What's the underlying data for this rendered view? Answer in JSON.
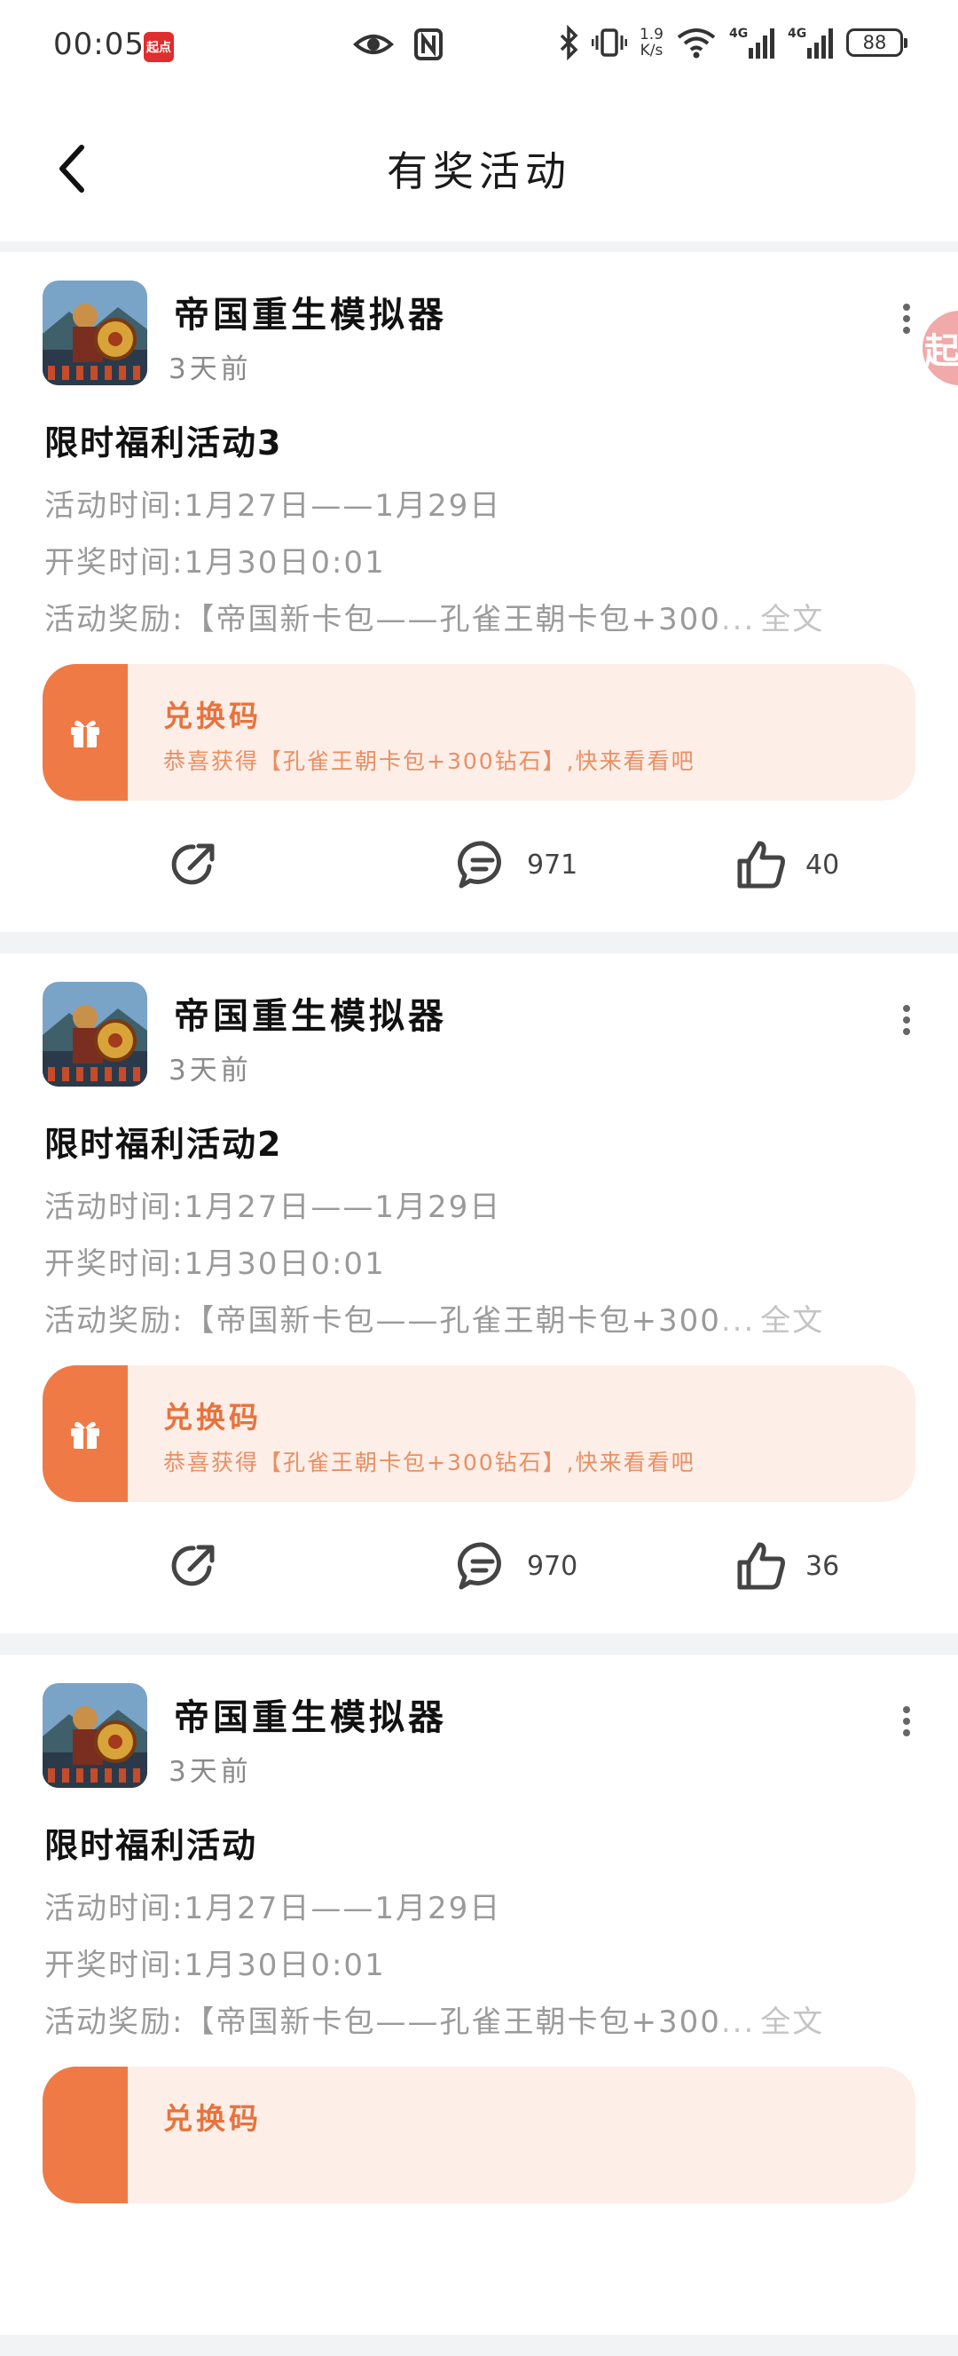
{
  "status_bar": {
    "time": "00:05",
    "app_badge": "起点",
    "net_speed_value": "1.9",
    "net_speed_unit": "K/s",
    "battery": "88"
  },
  "header": {
    "title": "有奖活动"
  },
  "floating_badge": "起",
  "posts": [
    {
      "game_name": "帝国重生模拟器",
      "time_ago": "3天前",
      "title": "限时福利活动3",
      "activity_time": "活动时间:1月27日——1月29日",
      "draw_time": "开奖时间:1月30日0:01",
      "reward": "活动奖励:【帝国新卡包——孔雀王朝卡包+300",
      "ellipsis": "...",
      "full_text_label": "全文",
      "code_title": "兑换码",
      "code_desc": "恭喜获得【孔雀王朝卡包+300钻石】,快来看看吧",
      "comments": "971",
      "likes": "40"
    },
    {
      "game_name": "帝国重生模拟器",
      "time_ago": "3天前",
      "title": "限时福利活动2",
      "activity_time": "活动时间:1月27日——1月29日",
      "draw_time": "开奖时间:1月30日0:01",
      "reward": "活动奖励:【帝国新卡包——孔雀王朝卡包+300",
      "ellipsis": "...",
      "full_text_label": "全文",
      "code_title": "兑换码",
      "code_desc": "恭喜获得【孔雀王朝卡包+300钻石】,快来看看吧",
      "comments": "970",
      "likes": "36"
    },
    {
      "game_name": "帝国重生模拟器",
      "time_ago": "3天前",
      "title": "限时福利活动",
      "activity_time": "活动时间:1月27日——1月29日",
      "draw_time": "开奖时间:1月30日0:01",
      "reward": "活动奖励:【帝国新卡包——孔雀王朝卡包+300",
      "ellipsis": "...",
      "full_text_label": "全文",
      "code_title": "兑换码",
      "code_desc": "",
      "comments": "",
      "likes": ""
    }
  ],
  "colors": {
    "accent": "#ef7a46",
    "code_bg": "#fdeee7",
    "page_bg": "#f2f3f5"
  }
}
